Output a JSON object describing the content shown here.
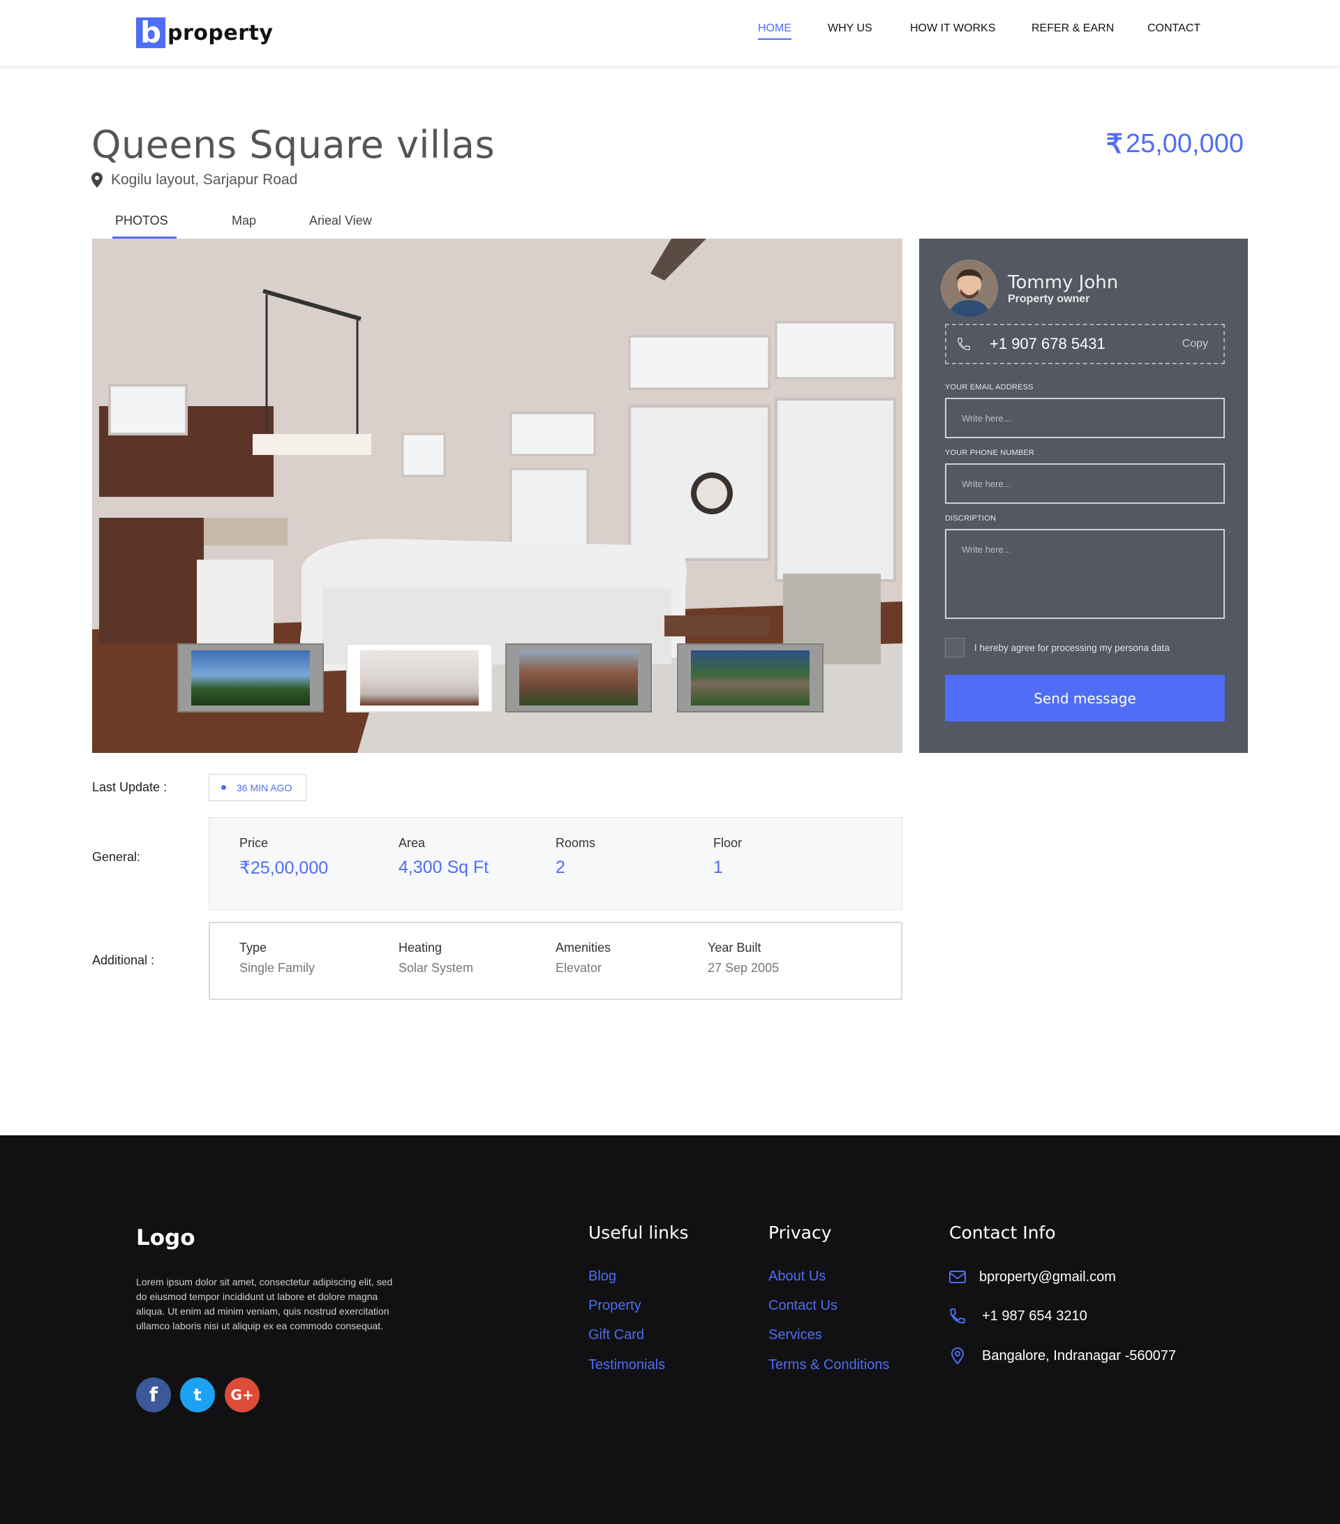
{
  "brand": {
    "mark": "b",
    "name": "property"
  },
  "nav": [
    "HOME",
    "WHY US",
    "HOW IT WORKS",
    "REFER & EARN",
    "CONTACT"
  ],
  "listing": {
    "title": "Queens Square villas",
    "location": "Kogilu layout, Sarjapur Road",
    "price": "25,00,000",
    "currency_symbol": "₹"
  },
  "tabs": [
    "PHOTOS",
    "Map",
    "Arieal View"
  ],
  "owner": {
    "name": "Tommy John",
    "role": "Property owner",
    "phone": "+1 907 678 5431",
    "copy_label": "Copy",
    "form": {
      "email_label": "YOUR EMAIL ADDRESS",
      "phone_label": "YOUR  PHONE NUMBER",
      "description_label": "DISCRIPTION",
      "placeholder": "Write here...",
      "agree_text": "I hereby agree for processing my persona data",
      "submit": "Send message"
    }
  },
  "details": {
    "last_update_label": "Last Update :",
    "last_update_value": "36 MIN AGO",
    "general_label": "General:",
    "general": [
      {
        "label": "Price",
        "value": "₹25,00,000"
      },
      {
        "label": "Area",
        "value": "4,300 Sq Ft"
      },
      {
        "label": "Rooms",
        "value": "2"
      },
      {
        "label": "Floor",
        "value": "1"
      }
    ],
    "additional_label": "Additional :",
    "additional": [
      {
        "label": "Type",
        "value": "Single Family"
      },
      {
        "label": "Heating",
        "value": "Solar System"
      },
      {
        "label": "Amenities",
        "value": "Elevator"
      },
      {
        "label": "Year Built",
        "value": "27 Sep 2005"
      }
    ]
  },
  "footer": {
    "logo": "Logo",
    "about": "Lorem ipsum dolor sit amet, consectetur adipiscing elit, sed do eiusmod tempor incididunt ut labore et dolore magna aliqua. Ut enim ad minim veniam, quis nostrud exercitation ullamco laboris nisi ut aliquip ex ea commodo consequat.",
    "social": [
      "f",
      "t",
      "G+"
    ],
    "useful_links_title": "Useful links",
    "useful_links": [
      "Blog",
      "Property",
      "Gift Card",
      "Testimonials"
    ],
    "privacy_title": "Privacy",
    "privacy_links": [
      "About Us",
      "Contact Us",
      "Services",
      "Terms & Conditions"
    ],
    "contact_title": "Contact Info",
    "contact": {
      "email": "bproperty@gmail.com",
      "phone": "+1 987 654 3210",
      "address": "Bangalore, Indranagar -560077"
    }
  },
  "colors": {
    "accent": "#4f6df5",
    "panel": "#535862",
    "footer": "#111113"
  }
}
